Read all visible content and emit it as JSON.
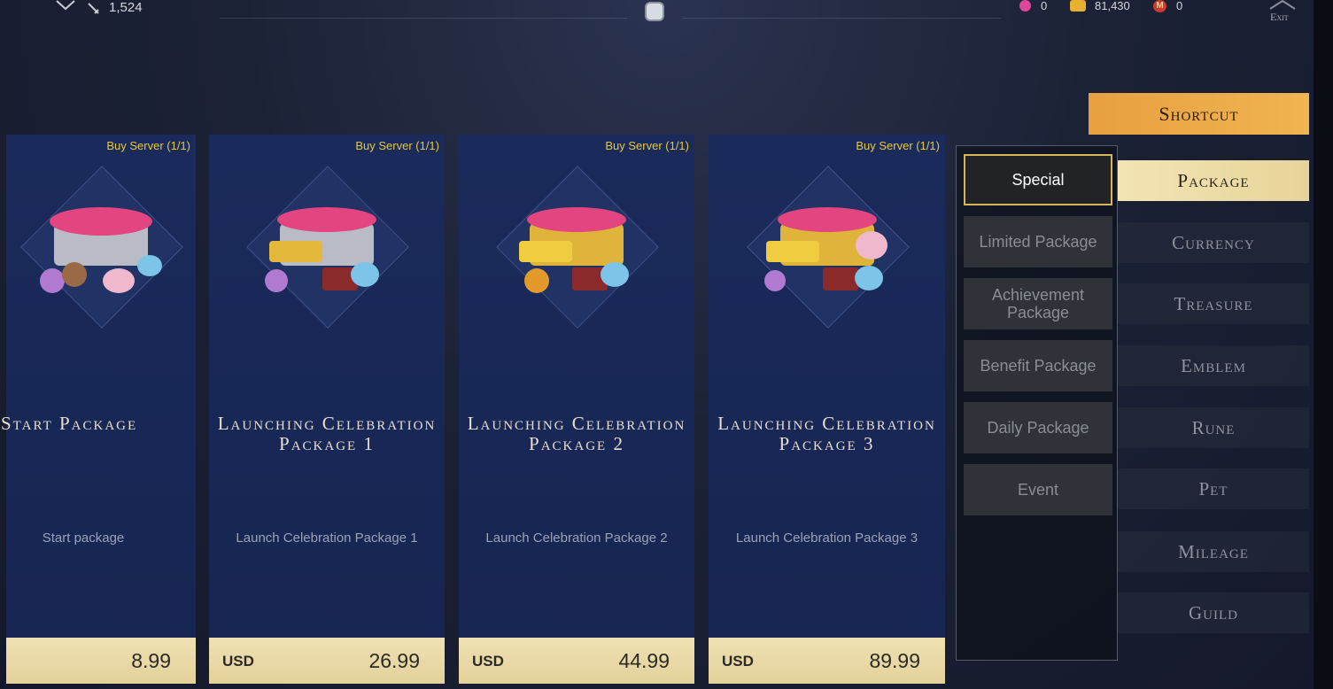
{
  "topbar": {
    "power_value": "1,524",
    "currencies": [
      {
        "icon": "pink-gem-icon",
        "value": "0",
        "color": "#e0479a"
      },
      {
        "icon": "gold-coin-icon",
        "value": "81,430",
        "color": "#e8b030"
      },
      {
        "icon": "mileage-m-icon",
        "value": "0",
        "color": "#d03a2a"
      }
    ],
    "exit_label": "Exit"
  },
  "shortcut_label": "Shortcut",
  "cards": [
    {
      "buy_limit": "Buy Server  (1/1)",
      "title": "Start Package",
      "desc": "Start package",
      "currency": "",
      "price": "8.99"
    },
    {
      "buy_limit": "Buy Server  (1/1)",
      "title": "Launching Celebration Package 1",
      "desc": "Launch Celebration Package 1",
      "currency": "USD",
      "price": "26.99"
    },
    {
      "buy_limit": "Buy Server  (1/1)",
      "title": "Launching Celebration Package 2",
      "desc": "Launch Celebration Package 2",
      "currency": "USD",
      "price": "44.99"
    },
    {
      "buy_limit": "Buy Server  (1/1)",
      "title": "Launching Celebration Package 3",
      "desc": "Launch Celebration Package 3",
      "currency": "USD",
      "price": "89.99"
    }
  ],
  "categories": [
    {
      "label": "Special",
      "active": true
    },
    {
      "label": "Limited Package",
      "active": false
    },
    {
      "label": "Achievement Package",
      "active": false
    },
    {
      "label": "Benefit Package",
      "active": false
    },
    {
      "label": "Daily Package",
      "active": false
    },
    {
      "label": "Event",
      "active": false
    }
  ],
  "tabs": [
    {
      "label": "Package",
      "active": true
    },
    {
      "label": "Currency",
      "active": false
    },
    {
      "label": "Treasure",
      "active": false
    },
    {
      "label": "Emblem",
      "active": false
    },
    {
      "label": "Rune",
      "active": false
    },
    {
      "label": "Pet",
      "active": false
    },
    {
      "label": "Mileage",
      "active": false
    },
    {
      "label": "Guild",
      "active": false
    }
  ],
  "colors": {
    "accent_gold": "#e6c93a",
    "shortcut_orange": "#eea648",
    "price_bar": "#ecdcab"
  }
}
